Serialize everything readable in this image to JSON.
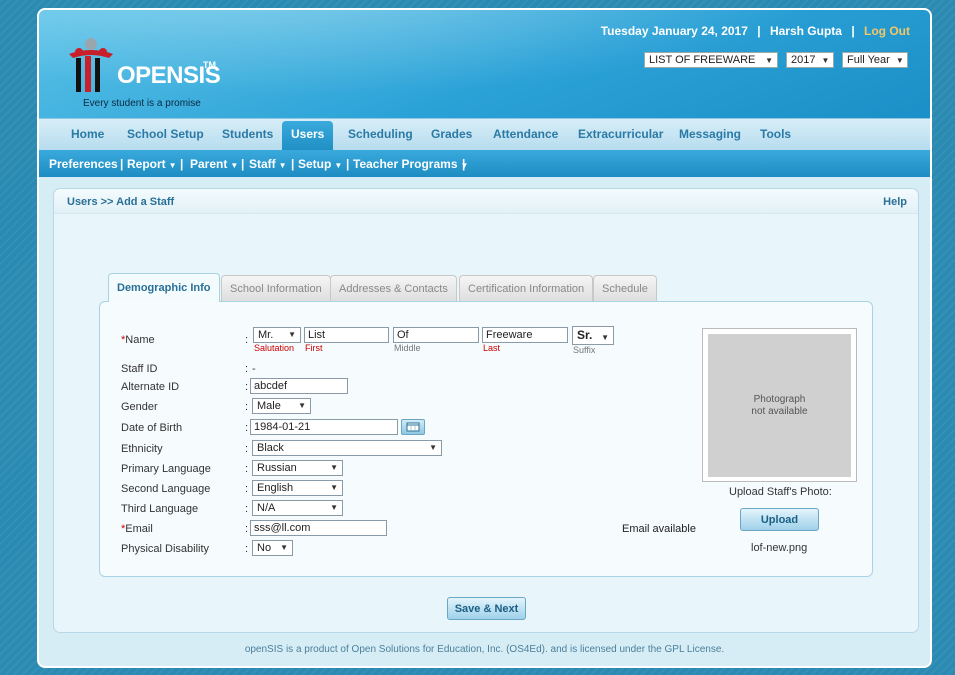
{
  "header": {
    "logo_text": "OPENSIS",
    "logo_tm": "TM",
    "tagline": "Every student is a promise",
    "date": "Tuesday January 24, 2017",
    "user": "Harsh Gupta",
    "logout": "Log Out",
    "school_select": "LIST OF FREEWARE",
    "year_select": "2017",
    "term_select": "Full Year"
  },
  "menu": {
    "items": [
      "Home",
      "School Setup",
      "Students",
      "Users",
      "Scheduling",
      "Grades",
      "Attendance",
      "Extracurricular",
      "Messaging",
      "Tools"
    ],
    "active": "Users"
  },
  "submenu": {
    "items": [
      "Preferences",
      "Report",
      "Parent",
      "Staff",
      "Setup",
      "Teacher Programs"
    ]
  },
  "page": {
    "breadcrumb": "Users >> Add a Staff",
    "help": "Help"
  },
  "tabs": [
    "Demographic Info",
    "School Information",
    "Addresses & Contacts",
    "Certification Information",
    "Schedule"
  ],
  "form": {
    "labels": {
      "name": "Name",
      "staff_id": "Staff ID",
      "alt_id": "Alternate ID",
      "gender": "Gender",
      "dob": "Date of Birth",
      "ethnicity": "Ethnicity",
      "primary_lang": "Primary Language",
      "second_lang": "Second Language",
      "third_lang": "Third Language",
      "email": "Email",
      "disability": "Physical Disability"
    },
    "sublabels": {
      "salutation": "Salutation",
      "first": "First",
      "middle": "Middle",
      "last": "Last",
      "suffix": "Suffix"
    },
    "values": {
      "salutation": "Mr.",
      "first": "List",
      "middle": "Of",
      "last": "Freeware",
      "suffix": "Sr.",
      "staff_id": "-",
      "alt_id": "abcdef",
      "gender": "Male",
      "dob": "1984-01-21",
      "ethnicity": "Black",
      "primary_lang": "Russian",
      "second_lang": "English",
      "third_lang": "N/A",
      "email": "sss@ll.com",
      "disability": "No"
    },
    "email_status": "Email available",
    "required_mark": "*",
    "colon": ":"
  },
  "photo": {
    "placeholder_line1": "Photograph",
    "placeholder_line2": "not available",
    "upload_label": "Upload Staff's Photo:",
    "upload_button": "Upload",
    "filename": "lof-new.png"
  },
  "actions": {
    "save_next": "Save & Next"
  },
  "footer": {
    "text": "openSIS is a product of Open Solutions for Education, Inc. (OS4Ed). and is licensed under the GPL License."
  }
}
